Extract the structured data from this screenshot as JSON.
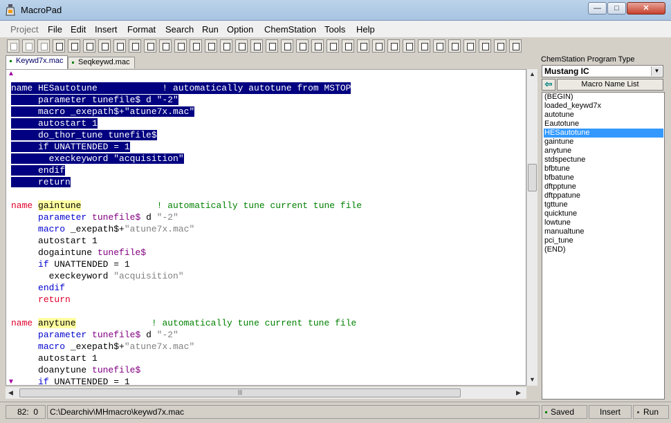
{
  "window": {
    "title": "MacroPad"
  },
  "menu": [
    "Project",
    "File",
    "Edit",
    "Insert",
    "Format",
    "Search",
    "Run",
    "Option",
    "ChemStation",
    "Tools",
    "Help"
  ],
  "tabs": [
    "Keywd7x.mac",
    "Seqkeywd.mac"
  ],
  "editor": {
    "lines": [
      [
        "name HESautotune            ! automatically autotune from MSTOP"
      ],
      [
        "     parameter tunefile$ d \"-2\""
      ],
      [
        "     macro _exepath$+\"atune7x.mac\""
      ],
      [
        "     autostart 1"
      ],
      [
        "     do_thor_tune tunefile$"
      ],
      [
        "     if UNATTENDED = 1"
      ],
      [
        "       execkeyword \"acquisition\""
      ],
      [
        "     endif"
      ],
      [
        "     return"
      ],
      [
        ""
      ],
      [
        "name ",
        "gaintune",
        "              ",
        "! automatically tune current tune file"
      ],
      [
        "     ",
        "parameter",
        " ",
        "tunefile$",
        " d ",
        "\"-2\""
      ],
      [
        "     ",
        "macro",
        " _exepath$+",
        "\"atune7x.mac\""
      ],
      [
        "     autostart 1"
      ],
      [
        "     dogaintune ",
        "tunefile$"
      ],
      [
        "     ",
        "if",
        " UNATTENDED = 1"
      ],
      [
        "       execkeyword ",
        "\"acquisition\""
      ],
      [
        "     ",
        "endif"
      ],
      [
        "     ",
        "return"
      ],
      [
        ""
      ],
      [
        "name ",
        "anytune",
        "              ",
        "! automatically tune current tune file"
      ],
      [
        "     ",
        "parameter",
        " ",
        "tunefile$",
        " d ",
        "\"-2\""
      ],
      [
        "     ",
        "macro",
        " _exepath$+",
        "\"atune7x.mac\""
      ],
      [
        "     autostart 1"
      ],
      [
        "     doanytune ",
        "tunefile$"
      ],
      [
        "     ",
        "if",
        " UNATTENDED = 1"
      ]
    ]
  },
  "panel": {
    "type_label": "ChemStation Program Type",
    "type_value": "Mustang IC",
    "list_button": "Macro Name List",
    "macros": [
      "(BEGIN)",
      "loaded_keywd7x",
      "autotune",
      "Eautotune",
      "HESautotune",
      "gaintune",
      "anytune",
      "stdspectune",
      "bfbtune",
      "bfbatune",
      "dftpptune",
      "dftppatune",
      "tgttune",
      "quicktune",
      "lowtune",
      "manualtune",
      "pci_tune",
      "(END)"
    ],
    "selected_macro": "HESautotune"
  },
  "status": {
    "line": "82",
    "col": "0",
    "path": "C:\\Dearchiv\\MHmacro\\keywd7x.mac",
    "saved": "Saved",
    "mode": "Insert",
    "run": "Run"
  }
}
